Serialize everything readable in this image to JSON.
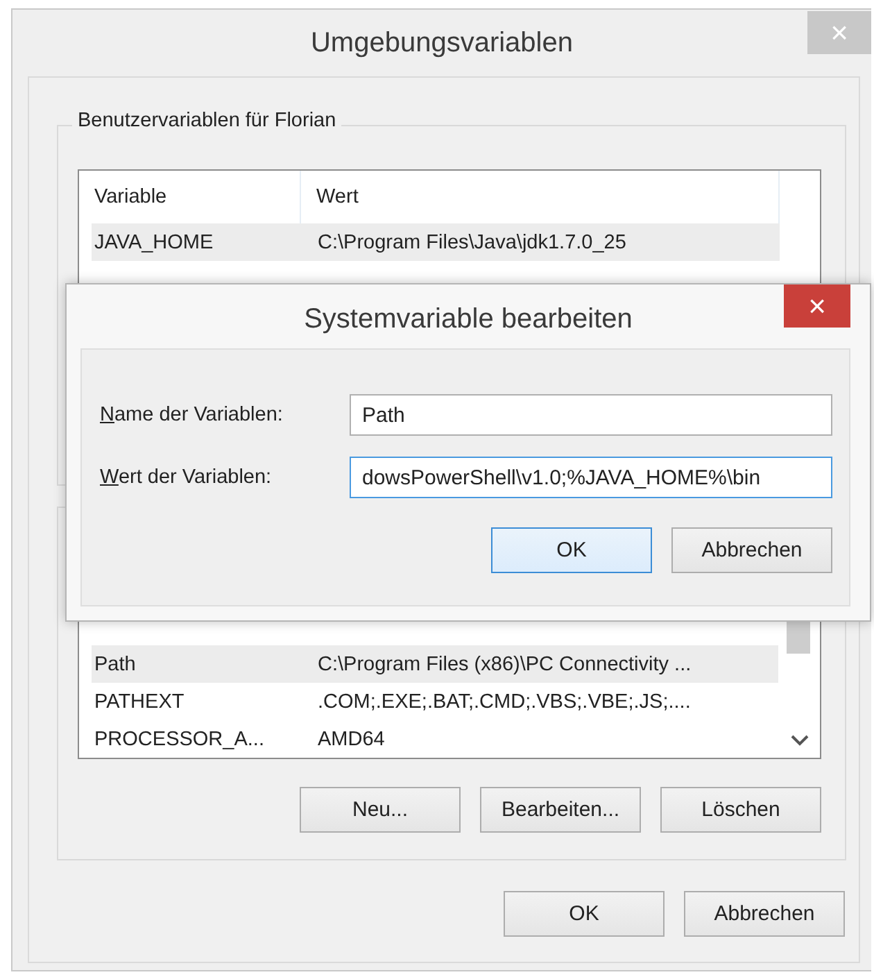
{
  "window": {
    "title": "Umgebungsvariablen",
    "close": "×"
  },
  "user_variables": {
    "legend": "Benutzervariablen für Florian",
    "columns": [
      "Variable",
      "Wert"
    ],
    "rows": [
      {
        "variable": "JAVA_HOME",
        "value": "C:\\Program Files\\Java\\jdk1.7.0_25",
        "selected": true
      }
    ]
  },
  "system_variables": {
    "rows": [
      {
        "variable": "Path",
        "value": "C:\\Program Files (x86)\\PC Connectivity ...",
        "selected": true
      },
      {
        "variable": "PATHEXT",
        "value": ".COM;.EXE;.BAT;.CMD;.VBS;.VBE;.JS;....",
        "selected": false
      },
      {
        "variable": "PROCESSOR_A...",
        "value": "AMD64",
        "selected": false
      }
    ],
    "buttons": [
      "Neu...",
      "Bearbeiten...",
      "Löschen"
    ]
  },
  "buttons": [
    {
      "label": "OK",
      "default": false
    },
    {
      "label": "Abbrechen",
      "default": false
    }
  ],
  "edit_dialog": {
    "title": "Systemvariable bearbeiten",
    "close": "×",
    "fields": [
      {
        "label": "Name der Variablen:",
        "value": "Path",
        "focused": false
      },
      {
        "label": "Wert der Variablen:",
        "value": "dowsPowerShell\\v1.0;%JAVA_HOME%\\bin",
        "focused": true
      }
    ],
    "buttons": [
      {
        "label": "OK",
        "default": true
      },
      {
        "label": "Abbrechen",
        "default": false
      }
    ]
  }
}
